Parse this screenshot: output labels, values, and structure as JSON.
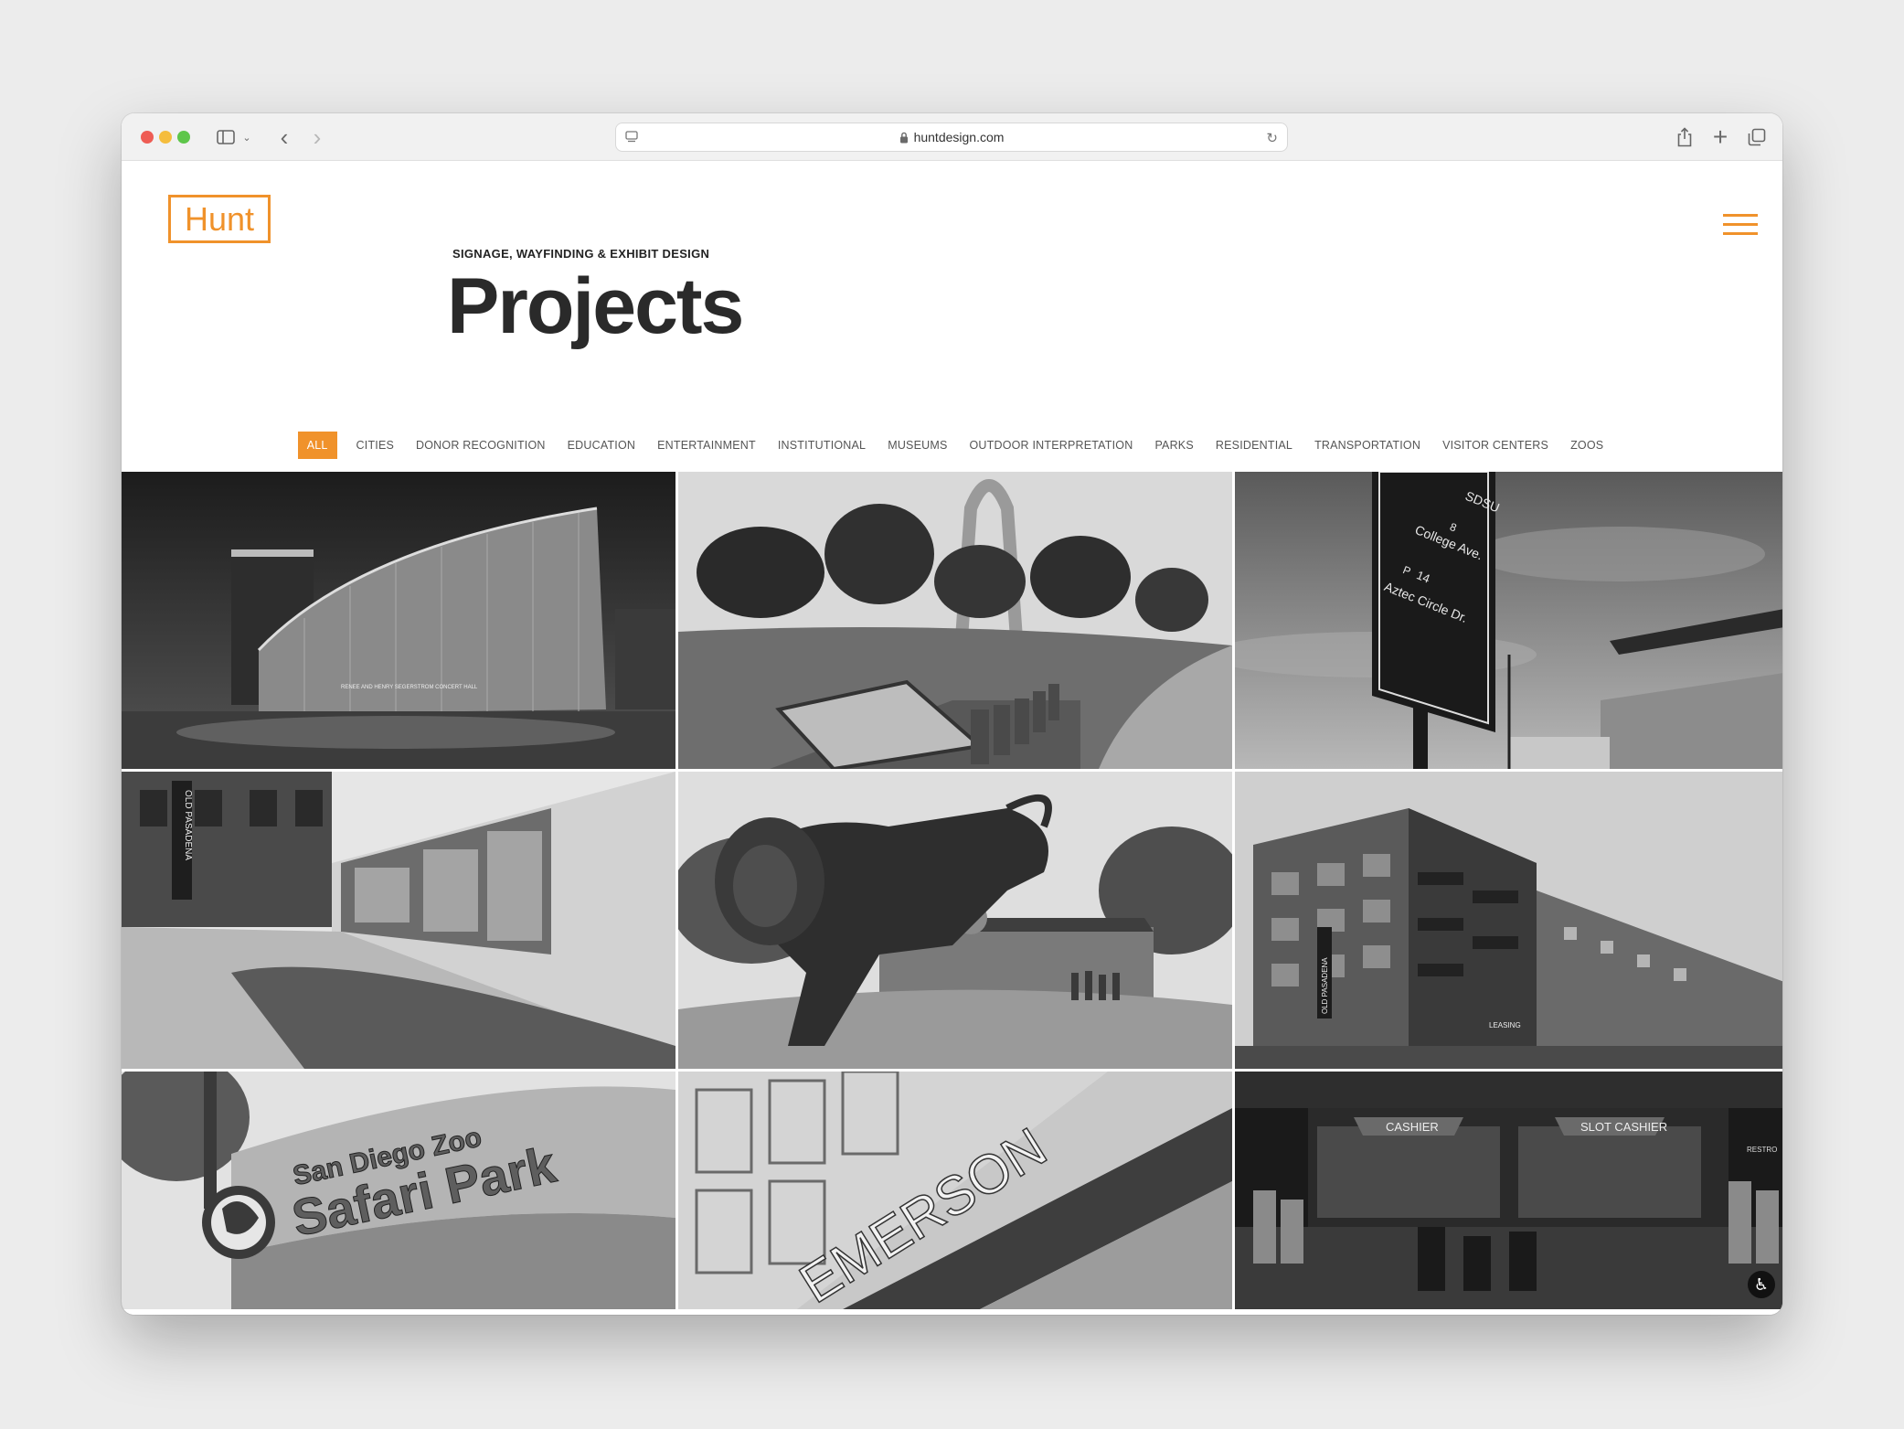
{
  "browser": {
    "url": "huntdesign.com",
    "icons": [
      "sidebar-icon",
      "chevron-down-icon",
      "back-icon",
      "forward-icon",
      "lock-icon",
      "reload-icon",
      "share-icon",
      "plus-icon",
      "tabs-icon"
    ]
  },
  "header": {
    "logo": "Hunt",
    "kicker": "SIGNAGE, WAYFINDING & EXHIBIT DESIGN",
    "title": "Projects",
    "menu_icon": "hamburger-icon"
  },
  "filters": [
    "ALL",
    "CITIES",
    "DONOR RECOGNITION",
    "EDUCATION",
    "ENTERTAINMENT",
    "INSTITUTIONAL",
    "MUSEUMS",
    "OUTDOOR INTERPRETATION",
    "PARKS",
    "RESIDENTIAL",
    "TRANSPORTATION",
    "VISITOR CENTERS",
    "ZOOS"
  ],
  "active_filter": "ALL",
  "accent_color": "#f0922b",
  "tiles": {
    "concert_hall_sign": "RENEE AND HENRY SEGERSTROM CONCERT HALL",
    "sdsu_sign_top": "SDSU",
    "sdsu_sign_badge": "8",
    "sdsu_sign_line1": "College Ave.",
    "sdsu_sign_badge2": "P",
    "sdsu_sign_num": "14",
    "sdsu_sign_line2": "Aztec Circle Dr.",
    "old_pasadena_1": "OLD PASADENA",
    "old_pasadena_2": "OLD PASADENA",
    "leasing": "LEASING",
    "safari_line1": "San Diego Zoo",
    "safari_line2": "Safari Park",
    "emerson": "EMERSON",
    "cashier": "CASHIER",
    "slot_cashier": "SLOT CASHIER",
    "restroom": "RESTRO"
  },
  "accessibility_icon": "accessibility-icon"
}
